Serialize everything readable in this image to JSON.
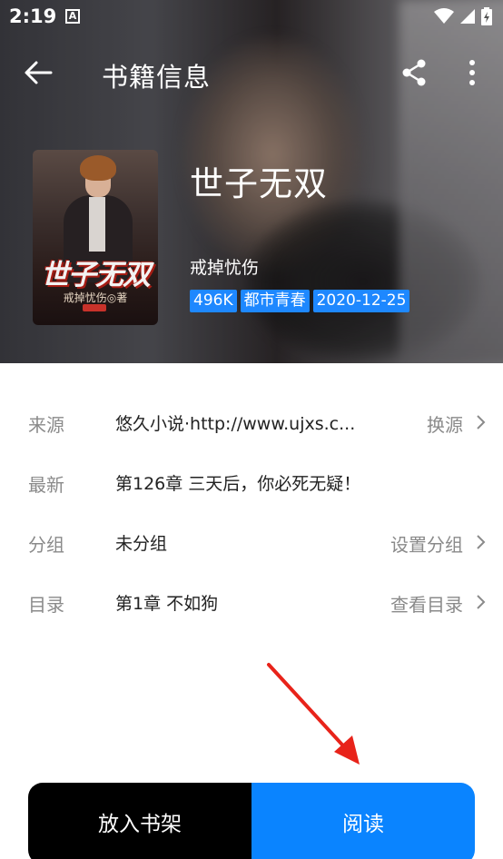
{
  "status_bar": {
    "time": "2:19",
    "notification_glyph": "A",
    "icons": [
      "wifi-icon",
      "signal-icon",
      "battery-icon"
    ]
  },
  "toolbar": {
    "title": "书籍信息",
    "icons": [
      "back-arrow-icon",
      "share-icon",
      "more-vertical-icon"
    ]
  },
  "book": {
    "cover_title": "世子无双",
    "cover_author": "戒掉忧伤◎著",
    "title": "世子无双",
    "author": "戒掉忧伤",
    "tags": [
      "496K",
      "都市青春",
      "2020-12-25"
    ]
  },
  "info_rows": [
    {
      "label": "来源",
      "value": "悠久小说·http://www.ujxs.c...",
      "action": "换源"
    },
    {
      "label": "最新",
      "value": "第126章 三天后，你必死无疑！",
      "action": ""
    },
    {
      "label": "分组",
      "value": "未分组",
      "action": "设置分组"
    },
    {
      "label": "目录",
      "value": "第1章 不如狗",
      "action": "查看目录"
    }
  ],
  "buttons": {
    "add_to_shelf": "放入书架",
    "read": "阅读"
  },
  "colors": {
    "accent": "#0a84ff",
    "tag": "#1e88ff",
    "annotation": "#e8231a"
  }
}
